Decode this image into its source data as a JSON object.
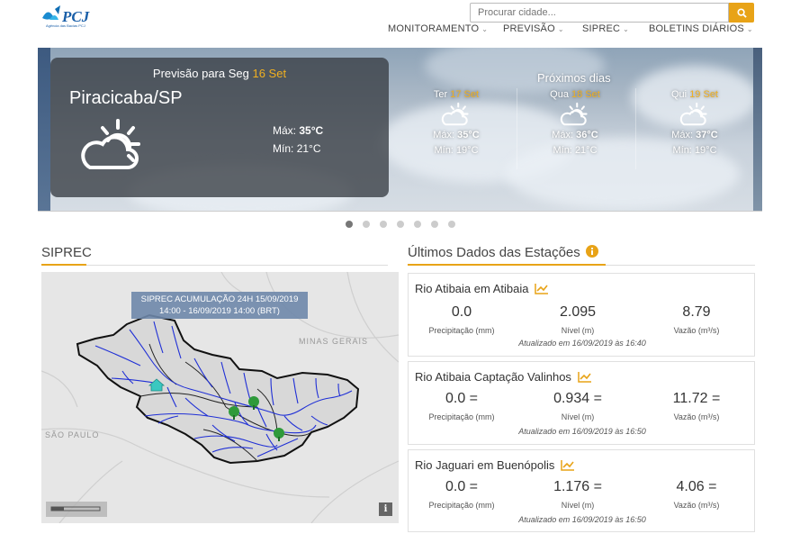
{
  "header": {
    "logo_caption": "Agência das Bacias PCJ",
    "search": {
      "placeholder": "Procurar cidade..."
    },
    "nav": [
      {
        "label": "MONITORAMENTO"
      },
      {
        "label": "PREVISÃO"
      },
      {
        "label": "SIPREC"
      },
      {
        "label": "BOLETINS DIÁRIOS"
      }
    ]
  },
  "forecast": {
    "heading_prefix": "Previsão para Seg",
    "heading_date": "16 Set",
    "city": "Piracicaba/SP",
    "today": {
      "max_label": "Máx:",
      "max": "35°C",
      "min_label": "Mín:",
      "min": "21°C",
      "icon": "partly-cloudy-icon"
    },
    "next_title": "Próximos dias",
    "next_days": [
      {
        "day": "Ter",
        "date": "17 Set",
        "max_label": "Máx:",
        "max": "35°C",
        "min_label": "Mín:",
        "min": "19°C",
        "icon": "partly-cloudy-icon"
      },
      {
        "day": "Qua",
        "date": "18 Set",
        "max_label": "Máx:",
        "max": "36°C",
        "min_label": "Mín:",
        "min": "21°C",
        "icon": "partly-cloudy-icon"
      },
      {
        "day": "Qui",
        "date": "19 Set",
        "max_label": "Máx:",
        "max": "37°C",
        "min_label": "Mín:",
        "min": "19°C",
        "icon": "partly-cloudy-icon"
      }
    ],
    "carousel": {
      "count": 7,
      "active": 1
    }
  },
  "siprec": {
    "title": "SIPREC",
    "map_label_line1": "SIPREC ACUMULAÇÃO 24H  15/09/2019",
    "map_label_line2": "14:00 - 16/09/2019 14:00 (BRT)",
    "region_mg": "MINAS GERAIS",
    "region_sp": "SÃO PAULO",
    "info_label": "i"
  },
  "stations": {
    "title": "Últimos Dados das Estações",
    "items": [
      {
        "name": "Rio Atibaia em Atibaia",
        "precip": "0.0",
        "precip_label": "Precipitação (mm)",
        "level": "2.095",
        "level_label": "Nível (m)",
        "flow": "8.79",
        "flow_label": "Vazão (m³/s)",
        "updated": "Atualizado em 16/09/2019 às 16:40"
      },
      {
        "name": "Rio Atibaia Captação Valinhos",
        "precip": "0.0 =",
        "precip_label": "Precipitação (mm)",
        "level": "0.934 =",
        "level_label": "Nível (m)",
        "flow": "11.72 =",
        "flow_label": "Vazão (m³/s)",
        "updated": "Atualizado em 16/09/2019 às 16:50"
      },
      {
        "name": "Rio Jaguari em Buenópolis",
        "precip": "0.0 =",
        "precip_label": "Precipitação (mm)",
        "level": "1.176 =",
        "level_label": "Nível (m)",
        "flow": "4.06 =",
        "flow_label": "Vazão (m³/s)",
        "updated": "Atualizado em 16/09/2019 às 16:50"
      }
    ]
  },
  "colors": {
    "accent": "#e8a317",
    "date_highlight": "#f0b020",
    "river": "#1f2fd6",
    "station_marker": "#2e9a3a"
  }
}
